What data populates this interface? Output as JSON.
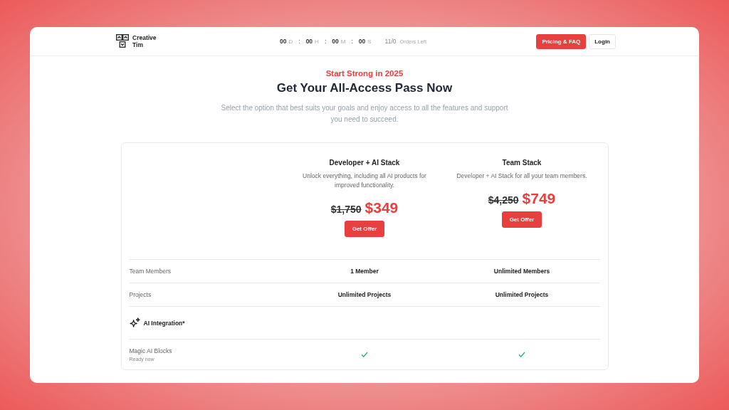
{
  "header": {
    "logo": {
      "line1": "Creative",
      "line2": "Tim"
    },
    "timer": [
      {
        "value": "00",
        "unit": "D"
      },
      {
        "value": "00",
        "unit": "H"
      },
      {
        "value": "00",
        "unit": "M"
      },
      {
        "value": "00",
        "unit": "S"
      }
    ],
    "timer_separator": ":",
    "orders_count": "11/0",
    "orders_label": "Orders Left",
    "buttons": [
      {
        "label": "Pricing & FAQ",
        "kind": "primary"
      },
      {
        "label": "Login",
        "kind": "outline"
      }
    ]
  },
  "hero": {
    "eyebrow": "Start Strong in 2025",
    "title": "Get Your All-Access Pass Now",
    "subtitle": "Select the option that best suits your goals and enjoy access to all the features and support you need to succeed."
  },
  "plans": [
    {
      "name": "Developer + AI Stack",
      "description": "Unlock everything, including all AI products for improved functionality.",
      "old_price": "$1,750",
      "price": "$349",
      "button": "Get Offer"
    },
    {
      "name": "Team Stack",
      "description": "Developer + AI Stack for all your team members.",
      "old_price": "$4,250",
      "price": "$749",
      "button": "Get Offer"
    }
  ],
  "rows": [
    {
      "kind": "text",
      "label": "Team Members",
      "values": [
        "1 Member",
        "Unlimited Members"
      ]
    },
    {
      "kind": "text",
      "label": "Projects",
      "values": [
        "Unlimited Projects",
        "Unlimited Projects"
      ]
    },
    {
      "kind": "section",
      "label": "AI Integration*"
    },
    {
      "kind": "feature",
      "label": "Magic AI Blocks",
      "note": "Ready now",
      "included": [
        true,
        true
      ]
    }
  ]
}
